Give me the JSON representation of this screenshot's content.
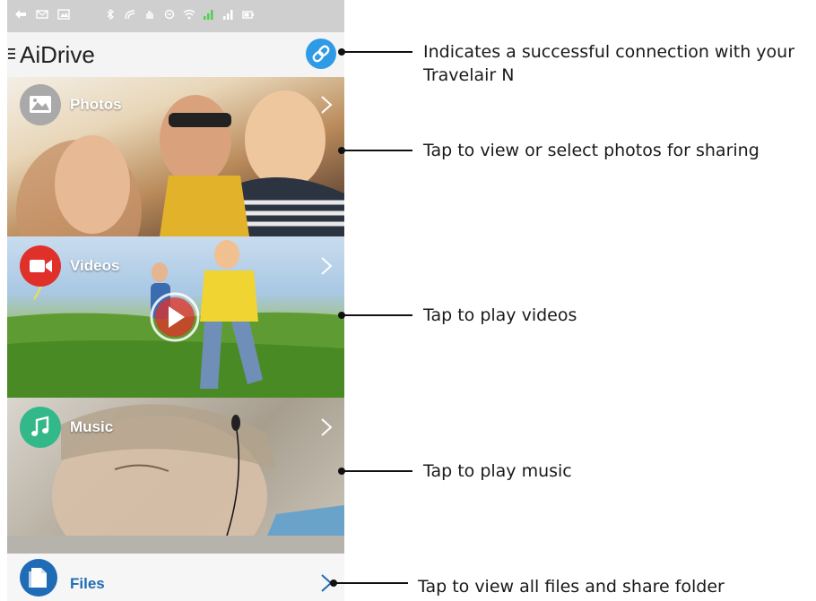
{
  "app": {
    "title": "AiDrive"
  },
  "icons": {
    "menu": "menu-icon",
    "link": "link-icon",
    "photos": "image-icon",
    "videos": "video-camera-icon",
    "music": "music-note-icon",
    "files": "document-icon",
    "chevron": "chevron-right-icon"
  },
  "colors": {
    "link_button": "#2f9be7",
    "photos_icon": "#a9a9a9",
    "videos_icon": "#e0302a",
    "music_icon": "#33b889",
    "files_icon": "#1f6bb5",
    "files_label": "#1f6bb5"
  },
  "tiles": [
    {
      "label": "Photos"
    },
    {
      "label": "Videos"
    },
    {
      "label": "Music"
    },
    {
      "label": "Files"
    }
  ],
  "annotations": {
    "connection_line1": "Indicates a successful connection with your",
    "connection_line2": "Travelair N",
    "photos": "Tap to view or select photos for sharing",
    "videos": "Tap to play videos",
    "music": "Tap to play music",
    "files": "Tap to view all files and share folder"
  }
}
